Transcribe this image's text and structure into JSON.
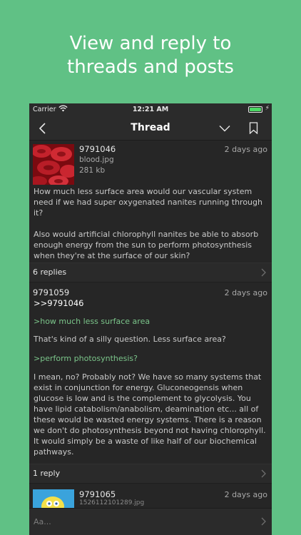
{
  "headline": [
    "View and reply to",
    "threads and posts"
  ],
  "status_bar": {
    "carrier": "Carrier",
    "time": "12:21 AM"
  },
  "nav": {
    "title": "Thread",
    "icons": [
      "back-chevron-icon",
      "chevron-down-icon",
      "bookmark-icon"
    ]
  },
  "op": {
    "id": "9791046",
    "filename": "blood.jpg",
    "filesize": "281 kb",
    "date": "2 days ago",
    "paragraphs": [
      "How much less surface area would our vascular system need if we had super oxygenated nanites running through it?",
      "Also would artificial chlorophyll nanites be able to absorb enough energy from the sun to perform photosynthesis when they're at the surface of our skin?"
    ],
    "replies_label": "6 replies"
  },
  "reply1": {
    "id": "9791059",
    "date": "2 days ago",
    "quote_link": ">>9791046",
    "greentext1": ">how much less surface area",
    "text1": "That's kind of a silly question. Less surface area?",
    "greentext2": ">perform photosynthesis?",
    "text2": "I mean, no? Probably not? We have so many systems that exist in conjunction for energy. Gluconeogensis when glucose is low and is the complement to glycolysis. You have lipid catabolism/anabolism, deamination etc... all of these would be wasted energy systems. There is a reason we don't do photosynthesis beyond not having chlorophyll. It would simply be a waste of like half of our biochemical pathways.",
    "replies_label": "1 reply"
  },
  "reply2": {
    "id": "9791065",
    "date": "2 days ago",
    "sub": "1526112101289.jpg"
  },
  "compose": {
    "placeholder": "Aa..."
  },
  "colors": {
    "background": "#60c185",
    "app_bg": "#262626",
    "greentext": "#7bc58a"
  }
}
